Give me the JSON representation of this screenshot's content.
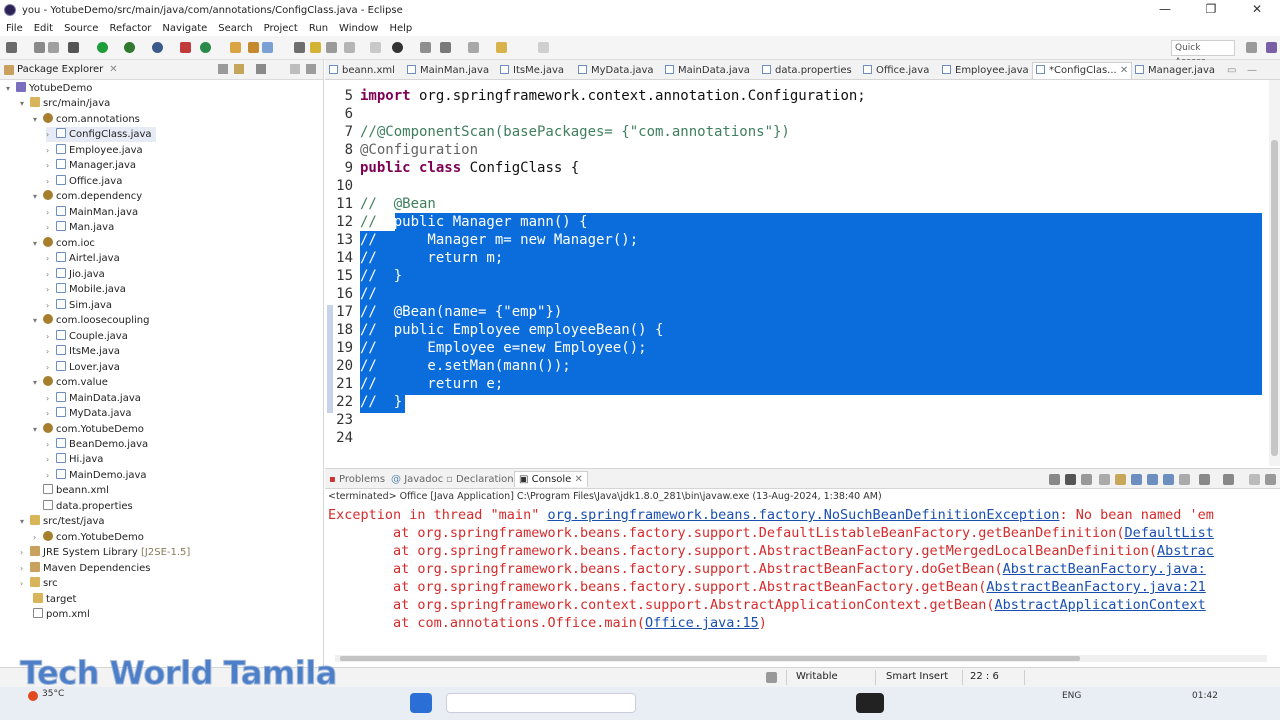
{
  "window": {
    "title": "you - YotubeDemo/src/main/java/com/annotations/ConfigClass.java - Eclipse",
    "minimize": "—",
    "maximize": "❐",
    "close": "✕"
  },
  "menu": [
    "File",
    "Edit",
    "Source",
    "Refactor",
    "Navigate",
    "Search",
    "Project",
    "Run",
    "Window",
    "Help"
  ],
  "toolbar": {
    "quick_access": "Quick Access"
  },
  "explorer": {
    "title": "Package Explorer",
    "tree": [
      {
        "label": "YotubeDemo",
        "icon": "project-icon"
      },
      {
        "label": "src/main/java",
        "icon": "source-folder-icon"
      },
      {
        "label": "com.annotations",
        "icon": "package-icon"
      },
      {
        "label": "ConfigClass.java",
        "icon": "java-file-icon"
      },
      {
        "label": "Employee.java",
        "icon": "java-file-icon"
      },
      {
        "label": "Manager.java",
        "icon": "java-file-icon"
      },
      {
        "label": "Office.java",
        "icon": "java-file-icon"
      },
      {
        "label": "com.dependency",
        "icon": "package-icon"
      },
      {
        "label": "MainMan.java",
        "icon": "java-file-icon"
      },
      {
        "label": "Man.java",
        "icon": "java-file-icon"
      },
      {
        "label": "com.ioc",
        "icon": "package-icon"
      },
      {
        "label": "Airtel.java",
        "icon": "java-file-icon"
      },
      {
        "label": "Jio.java",
        "icon": "java-file-icon"
      },
      {
        "label": "Mobile.java",
        "icon": "java-file-icon"
      },
      {
        "label": "Sim.java",
        "icon": "java-file-icon"
      },
      {
        "label": "com.loosecoupling",
        "icon": "package-icon"
      },
      {
        "label": "Couple.java",
        "icon": "java-file-icon"
      },
      {
        "label": "ItsMe.java",
        "icon": "java-file-icon"
      },
      {
        "label": "Lover.java",
        "icon": "java-file-icon"
      },
      {
        "label": "com.value",
        "icon": "package-icon"
      },
      {
        "label": "MainData.java",
        "icon": "java-file-icon"
      },
      {
        "label": "MyData.java",
        "icon": "java-file-icon"
      },
      {
        "label": "com.YotubeDemo",
        "icon": "package-icon"
      },
      {
        "label": "BeanDemo.java",
        "icon": "java-file-icon"
      },
      {
        "label": "Hi.java",
        "icon": "java-file-icon"
      },
      {
        "label": "MainDemo.java",
        "icon": "java-file-icon"
      },
      {
        "label": "beann.xml",
        "icon": "xml-file-icon"
      },
      {
        "label": "data.properties",
        "icon": "properties-file-icon"
      },
      {
        "label": "src/test/java",
        "icon": "source-folder-icon"
      },
      {
        "label": "com.YotubeDemo",
        "icon": "package-icon"
      },
      {
        "label": "JRE System Library",
        "suffix": "[J2SE-1.5]",
        "icon": "library-icon"
      },
      {
        "label": "Maven Dependencies",
        "icon": "library-icon"
      },
      {
        "label": "src",
        "icon": "folder-icon"
      },
      {
        "label": "target",
        "icon": "folder-icon"
      },
      {
        "label": "pom.xml",
        "icon": "xml-file-icon"
      }
    ]
  },
  "editor": {
    "tabs": [
      "beann.xml",
      "MainMan.java",
      "ItsMe.java",
      "MyData.java",
      "MainData.java",
      "data.properties",
      "Office.java",
      "Employee.java",
      "*ConfigClas...",
      "Manager.java"
    ],
    "active_tab": "*ConfigClas...",
    "lines": [
      {
        "n": "5",
        "text": "import org.springframework.context.annotation.Configuration;"
      },
      {
        "n": "6",
        "text": ""
      },
      {
        "n": "7",
        "text": "//@ComponentScan(basePackages= {\"com.annotations\"})"
      },
      {
        "n": "8",
        "text": "@Configuration"
      },
      {
        "n": "9",
        "text": "public class ConfigClass {"
      },
      {
        "n": "10",
        "text": ""
      },
      {
        "n": "11",
        "text": "//  @Bean"
      },
      {
        "n": "12",
        "text": "//  public Manager mann() {"
      },
      {
        "n": "13",
        "text": "//      Manager m= new Manager();"
      },
      {
        "n": "14",
        "text": "//      return m;"
      },
      {
        "n": "15",
        "text": "//  }"
      },
      {
        "n": "16",
        "text": "//"
      },
      {
        "n": "17",
        "text": "//  @Bean(name= {\"emp\"})"
      },
      {
        "n": "18",
        "text": "//  public Employee employeeBean() {"
      },
      {
        "n": "19",
        "text": "//      Employee e=new Employee();"
      },
      {
        "n": "20",
        "text": "//      e.setMan(mann());"
      },
      {
        "n": "21",
        "text": "//      return e;"
      },
      {
        "n": "22",
        "text": "//  }"
      },
      {
        "n": "23",
        "text": ""
      },
      {
        "n": "24",
        "text": ""
      }
    ],
    "selection_color": "#0a6ddb"
  },
  "console": {
    "tabs": [
      "Problems",
      "Javadoc",
      "Declaration",
      "Console"
    ],
    "active_tab": "Console",
    "terminated": "<terminated> Office [Java Application] C:\\Program Files\\Java\\jdk1.8.0_281\\bin\\javaw.exe (13-Aug-2024, 1:38:40 AM)",
    "lines": [
      {
        "pre": "Exception in thread \"main\" ",
        "link": "org.springframework.beans.factory.NoSuchBeanDefinitionException",
        "post": ": No bean named 'em"
      },
      {
        "pre": "        at org.springframework.beans.factory.support.DefaultListableBeanFactory.getBeanDefinition(",
        "link": "DefaultList",
        "post": ""
      },
      {
        "pre": "        at org.springframework.beans.factory.support.AbstractBeanFactory.getMergedLocalBeanDefinition(",
        "link": "Abstrac",
        "post": ""
      },
      {
        "pre": "        at org.springframework.beans.factory.support.AbstractBeanFactory.doGetBean(",
        "link": "AbstractBeanFactory.java:",
        "post": ""
      },
      {
        "pre": "        at org.springframework.beans.factory.support.AbstractBeanFactory.getBean(",
        "link": "AbstractBeanFactory.java:21",
        "post": ""
      },
      {
        "pre": "        at org.springframework.context.support.AbstractApplicationContext.getBean(",
        "link": "AbstractApplicationContext",
        "post": ""
      },
      {
        "pre": "        at com.annotations.Office.main(",
        "link": "Office.java:15",
        "post": ")"
      }
    ],
    "error_color": "#d52b2b",
    "link_color": "#1a4fb0"
  },
  "statusbar": {
    "writable": "Writable",
    "insert_mode": "Smart Insert",
    "position": "22 : 6"
  },
  "watermark": "Tech World Tamila",
  "taskbar": {
    "weather": "35°C",
    "language": "ENG",
    "time": "01:42"
  }
}
